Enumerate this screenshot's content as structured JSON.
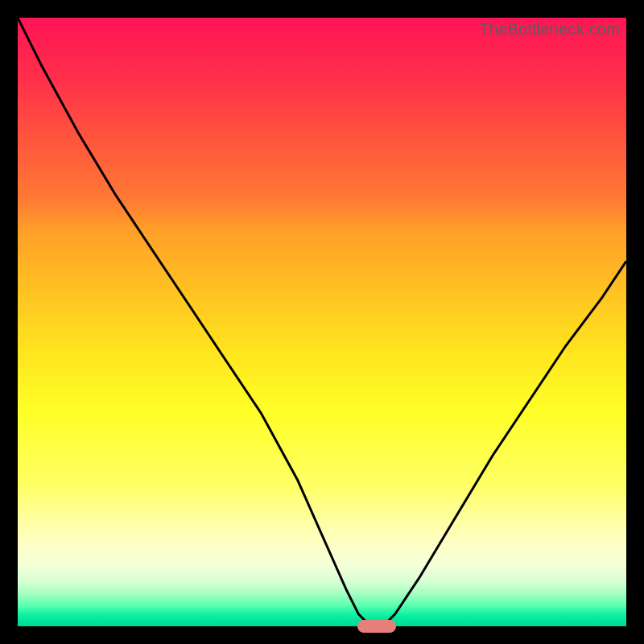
{
  "watermark": "TheBottleneck.com",
  "gradient_colors": {
    "top": "#ff1456",
    "mid_orange": "#ff8f2e",
    "mid_yellow": "#ffff28",
    "pale_yellow": "#feffc9",
    "bottom_green": "#00d893"
  },
  "frame_color": "#000000",
  "curve_color": "#000000",
  "marker_color": "#e77f7a",
  "chart_data": {
    "type": "line",
    "title": "",
    "xlabel": "",
    "ylabel": "",
    "xlim": [
      0,
      100
    ],
    "ylim": [
      0,
      100
    ],
    "grid": false,
    "legend": false,
    "series": [
      {
        "name": "bottleneck-curve",
        "x": [
          0,
          4,
          10,
          16,
          22,
          28,
          34,
          40,
          46,
          50,
          54,
          56,
          58,
          60,
          62,
          66,
          72,
          78,
          84,
          90,
          96,
          100
        ],
        "values": [
          100,
          92,
          81,
          71,
          62,
          53,
          44,
          35,
          24,
          15,
          6,
          2,
          0,
          0,
          2,
          8,
          18,
          28,
          37,
          46,
          54,
          60
        ]
      }
    ],
    "marker": {
      "x": 59,
      "y": 0,
      "shape": "pill",
      "color": "#e77f7a"
    },
    "annotations": [
      {
        "text": "TheBottleneck.com",
        "pos": "top-right",
        "role": "watermark"
      }
    ]
  }
}
